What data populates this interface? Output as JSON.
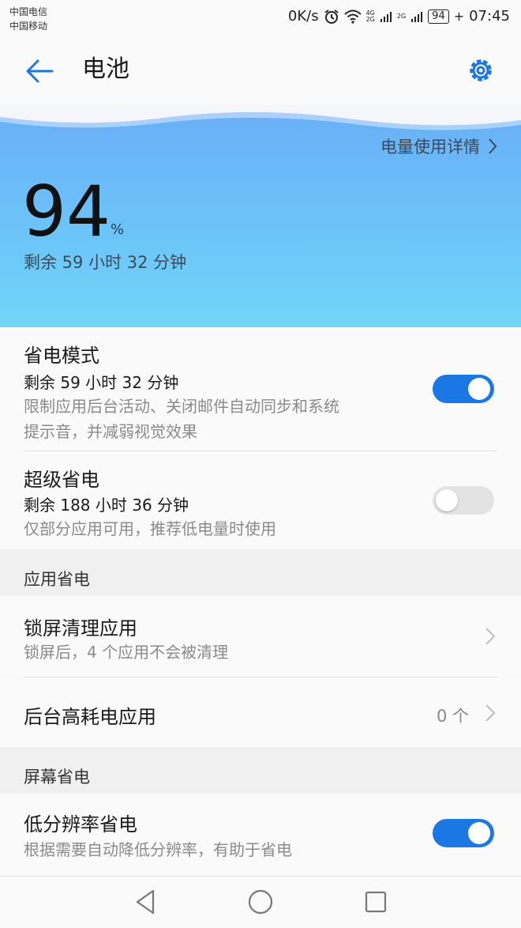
{
  "status": {
    "carrier1": "中国电信",
    "carrier2": "中国移动",
    "speed": "0K/s",
    "net1": "4G",
    "net2": "2G",
    "net3": "2G",
    "battery": "94",
    "time": "07:45"
  },
  "appbar": {
    "title": "电池"
  },
  "hero": {
    "detail_link": "电量使用详情",
    "percent": "94",
    "percent_sign": "%",
    "remaining": "剩余 59 小时 32 分钟"
  },
  "power_saving": {
    "title": "省电模式",
    "remaining": "剩余 59 小时 32 分钟",
    "desc_line1": "限制应用后台活动、关闭邮件自动同步和系统",
    "desc_line2": "提示音，并减弱视觉效果",
    "enabled": true
  },
  "ultra_saving": {
    "title": "超级省电",
    "remaining": "剩余 188 小时 36 分钟",
    "desc": "仅部分应用可用，推荐低电量时使用",
    "enabled": false
  },
  "app_section": {
    "title": "应用省电"
  },
  "lock_clean": {
    "title": "锁屏清理应用",
    "desc": "锁屏后，4 个应用不会被清理"
  },
  "bg_apps": {
    "title": "后台高耗电应用",
    "count": "0 个"
  },
  "screen_section": {
    "title": "屏幕省电"
  },
  "low_res": {
    "title": "低分辨率省电",
    "desc": "根据需要自动降低分辨率，有助于省电",
    "enabled": true
  },
  "colors": {
    "accent": "#1b77e4",
    "hero_top": "#69aef7",
    "hero_bottom": "#72d6f7"
  }
}
